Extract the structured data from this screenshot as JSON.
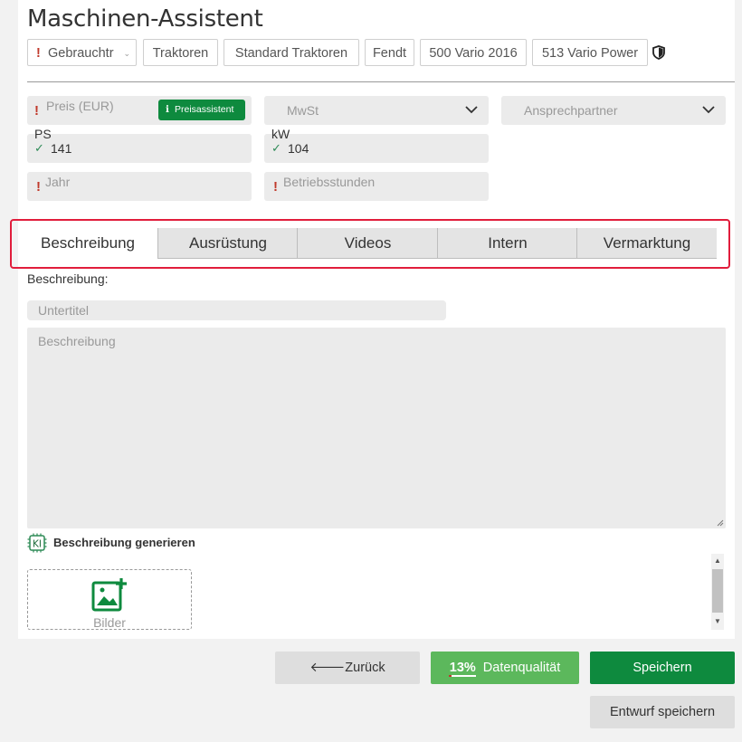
{
  "title": "Maschinen-Assistent",
  "breadcrumbs": [
    {
      "label": "Gebrauchtr",
      "required": "!"
    },
    {
      "label": "Traktoren"
    },
    {
      "label": "Standard Traktoren"
    },
    {
      "label": "Fendt"
    },
    {
      "label": "500 Vario 2016"
    },
    {
      "label": "513 Vario Power"
    }
  ],
  "fields": {
    "preis": {
      "placeholder": "Preis (EUR)",
      "required": "!",
      "button": "Preisassistent",
      "info": "i"
    },
    "mwst": {
      "placeholder": "MwSt"
    },
    "ansprechpartner": {
      "placeholder": "Ansprechpartner"
    },
    "ps": {
      "label": "PS",
      "value": "141",
      "check": "✓"
    },
    "kw": {
      "label": "kW",
      "value": "104",
      "check": "✓"
    },
    "jahr": {
      "placeholder": "Jahr",
      "required": "!"
    },
    "betriebsstunden": {
      "placeholder": "Betriebsstunden",
      "required": "!"
    }
  },
  "tabs": [
    "Beschreibung",
    "Ausrüstung",
    "Videos",
    "Intern",
    "Vermarktung"
  ],
  "active_tab": "Beschreibung",
  "description": {
    "section_label": "Beschreibung:",
    "subtitle_placeholder": "Untertitel",
    "body_placeholder": "Beschreibung",
    "ai_badge": "KI",
    "ai_label": "Beschreibung generieren",
    "images_label": "Bilder"
  },
  "buttons": {
    "back": "Zurück",
    "back_arrow": "🡐",
    "quality_percent": "13%",
    "quality_label": "Datenqualität",
    "save": "Speichern",
    "draft": "Entwurf speichern"
  },
  "colors": {
    "accent_green": "#0e8a3e",
    "quality_green": "#5cb85c",
    "highlight_red": "#e11d3c",
    "required_red": "#c0392b"
  }
}
